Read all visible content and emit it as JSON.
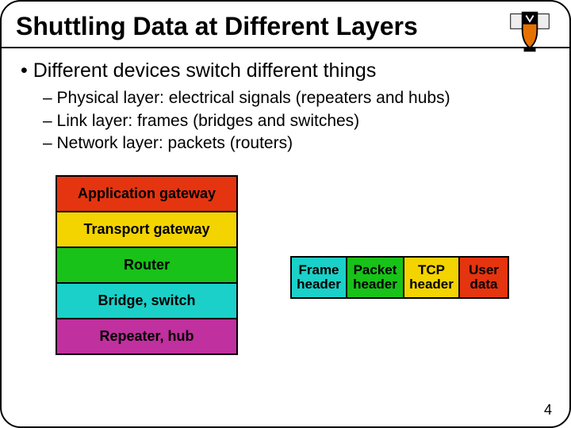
{
  "title": "Shuttling Data at Different Layers",
  "bullet_main": "• Different devices switch different things",
  "subs": {
    "a": "– Physical layer: electrical signals (repeaters and hubs)",
    "b": "– Link layer: frames (bridges and switches)",
    "c": "– Network layer: packets (routers)"
  },
  "stack": {
    "r0": "Application gateway",
    "r1": "Transport gateway",
    "r2": "Router",
    "r3": "Bridge, switch",
    "r4": "Repeater, hub"
  },
  "packet": {
    "s0a": "Frame",
    "s0b": "header",
    "s1a": "Packet",
    "s1b": "header",
    "s2a": "TCP",
    "s2b": "header",
    "s3a": "User",
    "s3b": "data"
  },
  "pagenum": "4",
  "colors": {
    "red": "#e53410",
    "yellow": "#f3d400",
    "green": "#18c218",
    "cyan": "#1bd0c8",
    "magenta": "#c0309e"
  }
}
